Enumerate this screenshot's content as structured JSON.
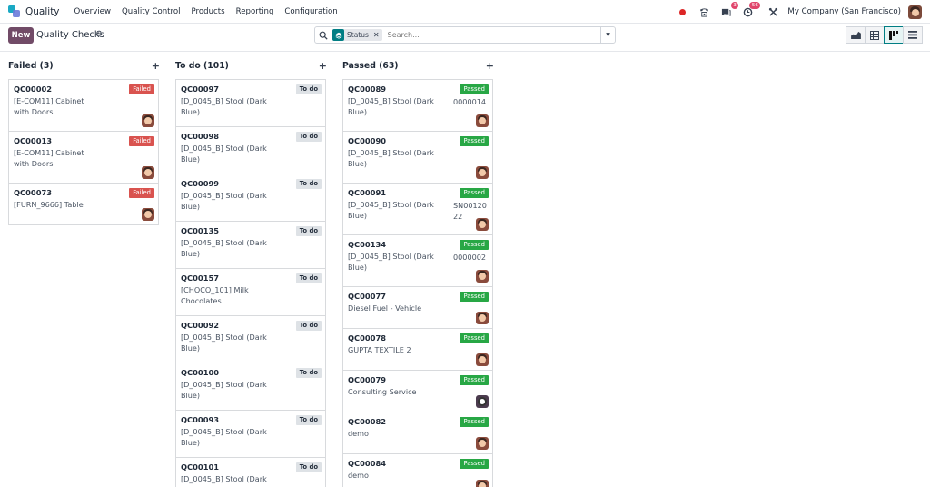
{
  "navbar": {
    "app_name": "Quality",
    "menu": [
      "Overview",
      "Quality Control",
      "Products",
      "Reporting",
      "Configuration"
    ],
    "activity_badge": "3",
    "clock_badge": "56",
    "company": "My Company (San Francisco)"
  },
  "controls": {
    "new_label": "New",
    "title": "Quality Checks",
    "facet_label": "Status",
    "search_placeholder": "Search..."
  },
  "columns": [
    {
      "title": "Failed (3)",
      "cards": [
        {
          "ref": "QC00002",
          "product": "[E-COM11] Cabinet with Doors",
          "status": "Failed",
          "lot": ""
        },
        {
          "ref": "QC00013",
          "product": "[E-COM11] Cabinet with Doors",
          "status": "Failed",
          "lot": ""
        },
        {
          "ref": "QC00073",
          "product": "[FURN_9666] Table",
          "status": "Failed",
          "lot": ""
        }
      ]
    },
    {
      "title": "To do (101)",
      "cards": [
        {
          "ref": "QC00097",
          "product": "[D_0045_B] Stool (Dark Blue)",
          "status": "To do",
          "lot": ""
        },
        {
          "ref": "QC00098",
          "product": "[D_0045_B] Stool (Dark Blue)",
          "status": "To do",
          "lot": ""
        },
        {
          "ref": "QC00099",
          "product": "[D_0045_B] Stool (Dark Blue)",
          "status": "To do",
          "lot": ""
        },
        {
          "ref": "QC00135",
          "product": "[D_0045_B] Stool (Dark Blue)",
          "status": "To do",
          "lot": ""
        },
        {
          "ref": "QC00157",
          "product": "[CHOCO_101] Milk Chocolates",
          "status": "To do",
          "lot": ""
        },
        {
          "ref": "QC00092",
          "product": "[D_0045_B] Stool (Dark Blue)",
          "status": "To do",
          "lot": ""
        },
        {
          "ref": "QC00100",
          "product": "[D_0045_B] Stool (Dark Blue)",
          "status": "To do",
          "lot": ""
        },
        {
          "ref": "QC00093",
          "product": "[D_0045_B] Stool (Dark Blue)",
          "status": "To do",
          "lot": ""
        },
        {
          "ref": "QC00101",
          "product": "[D_0045_B] Stool (Dark Blue)",
          "status": "To do",
          "lot": ""
        }
      ]
    },
    {
      "title": "Passed (63)",
      "cards": [
        {
          "ref": "QC00089",
          "product": "[D_0045_B] Stool (Dark Blue)",
          "status": "Passed",
          "lot": "0000014"
        },
        {
          "ref": "QC00090",
          "product": "[D_0045_B] Stool (Dark Blue)",
          "status": "Passed",
          "lot": ""
        },
        {
          "ref": "QC00091",
          "product": "[D_0045_B] Stool (Dark Blue)",
          "status": "Passed",
          "lot": "SN0012022"
        },
        {
          "ref": "QC00134",
          "product": "[D_0045_B] Stool (Dark Blue)",
          "status": "Passed",
          "lot": "0000002"
        },
        {
          "ref": "QC00077",
          "product": "Diesel Fuel - Vehicle",
          "status": "Passed",
          "lot": ""
        },
        {
          "ref": "QC00078",
          "product": "GUPTA TEXTILE 2",
          "status": "Passed",
          "lot": ""
        },
        {
          "ref": "QC00079",
          "product": "Consulting Service",
          "status": "Passed",
          "lot": ""
        },
        {
          "ref": "QC00082",
          "product": "demo",
          "status": "Passed",
          "lot": ""
        },
        {
          "ref": "QC00084",
          "product": "demo",
          "status": "Passed",
          "lot": ""
        }
      ]
    }
  ],
  "icons": {
    "app": "quality-app-icon",
    "search": "search-icon",
    "gear": "gear-icon",
    "add": "plus-icon"
  },
  "colors": {
    "primary": "#714b67",
    "failed": "#d9534f",
    "passed": "#28a745",
    "todo": "#dee2e6",
    "facet": "#017e84"
  }
}
